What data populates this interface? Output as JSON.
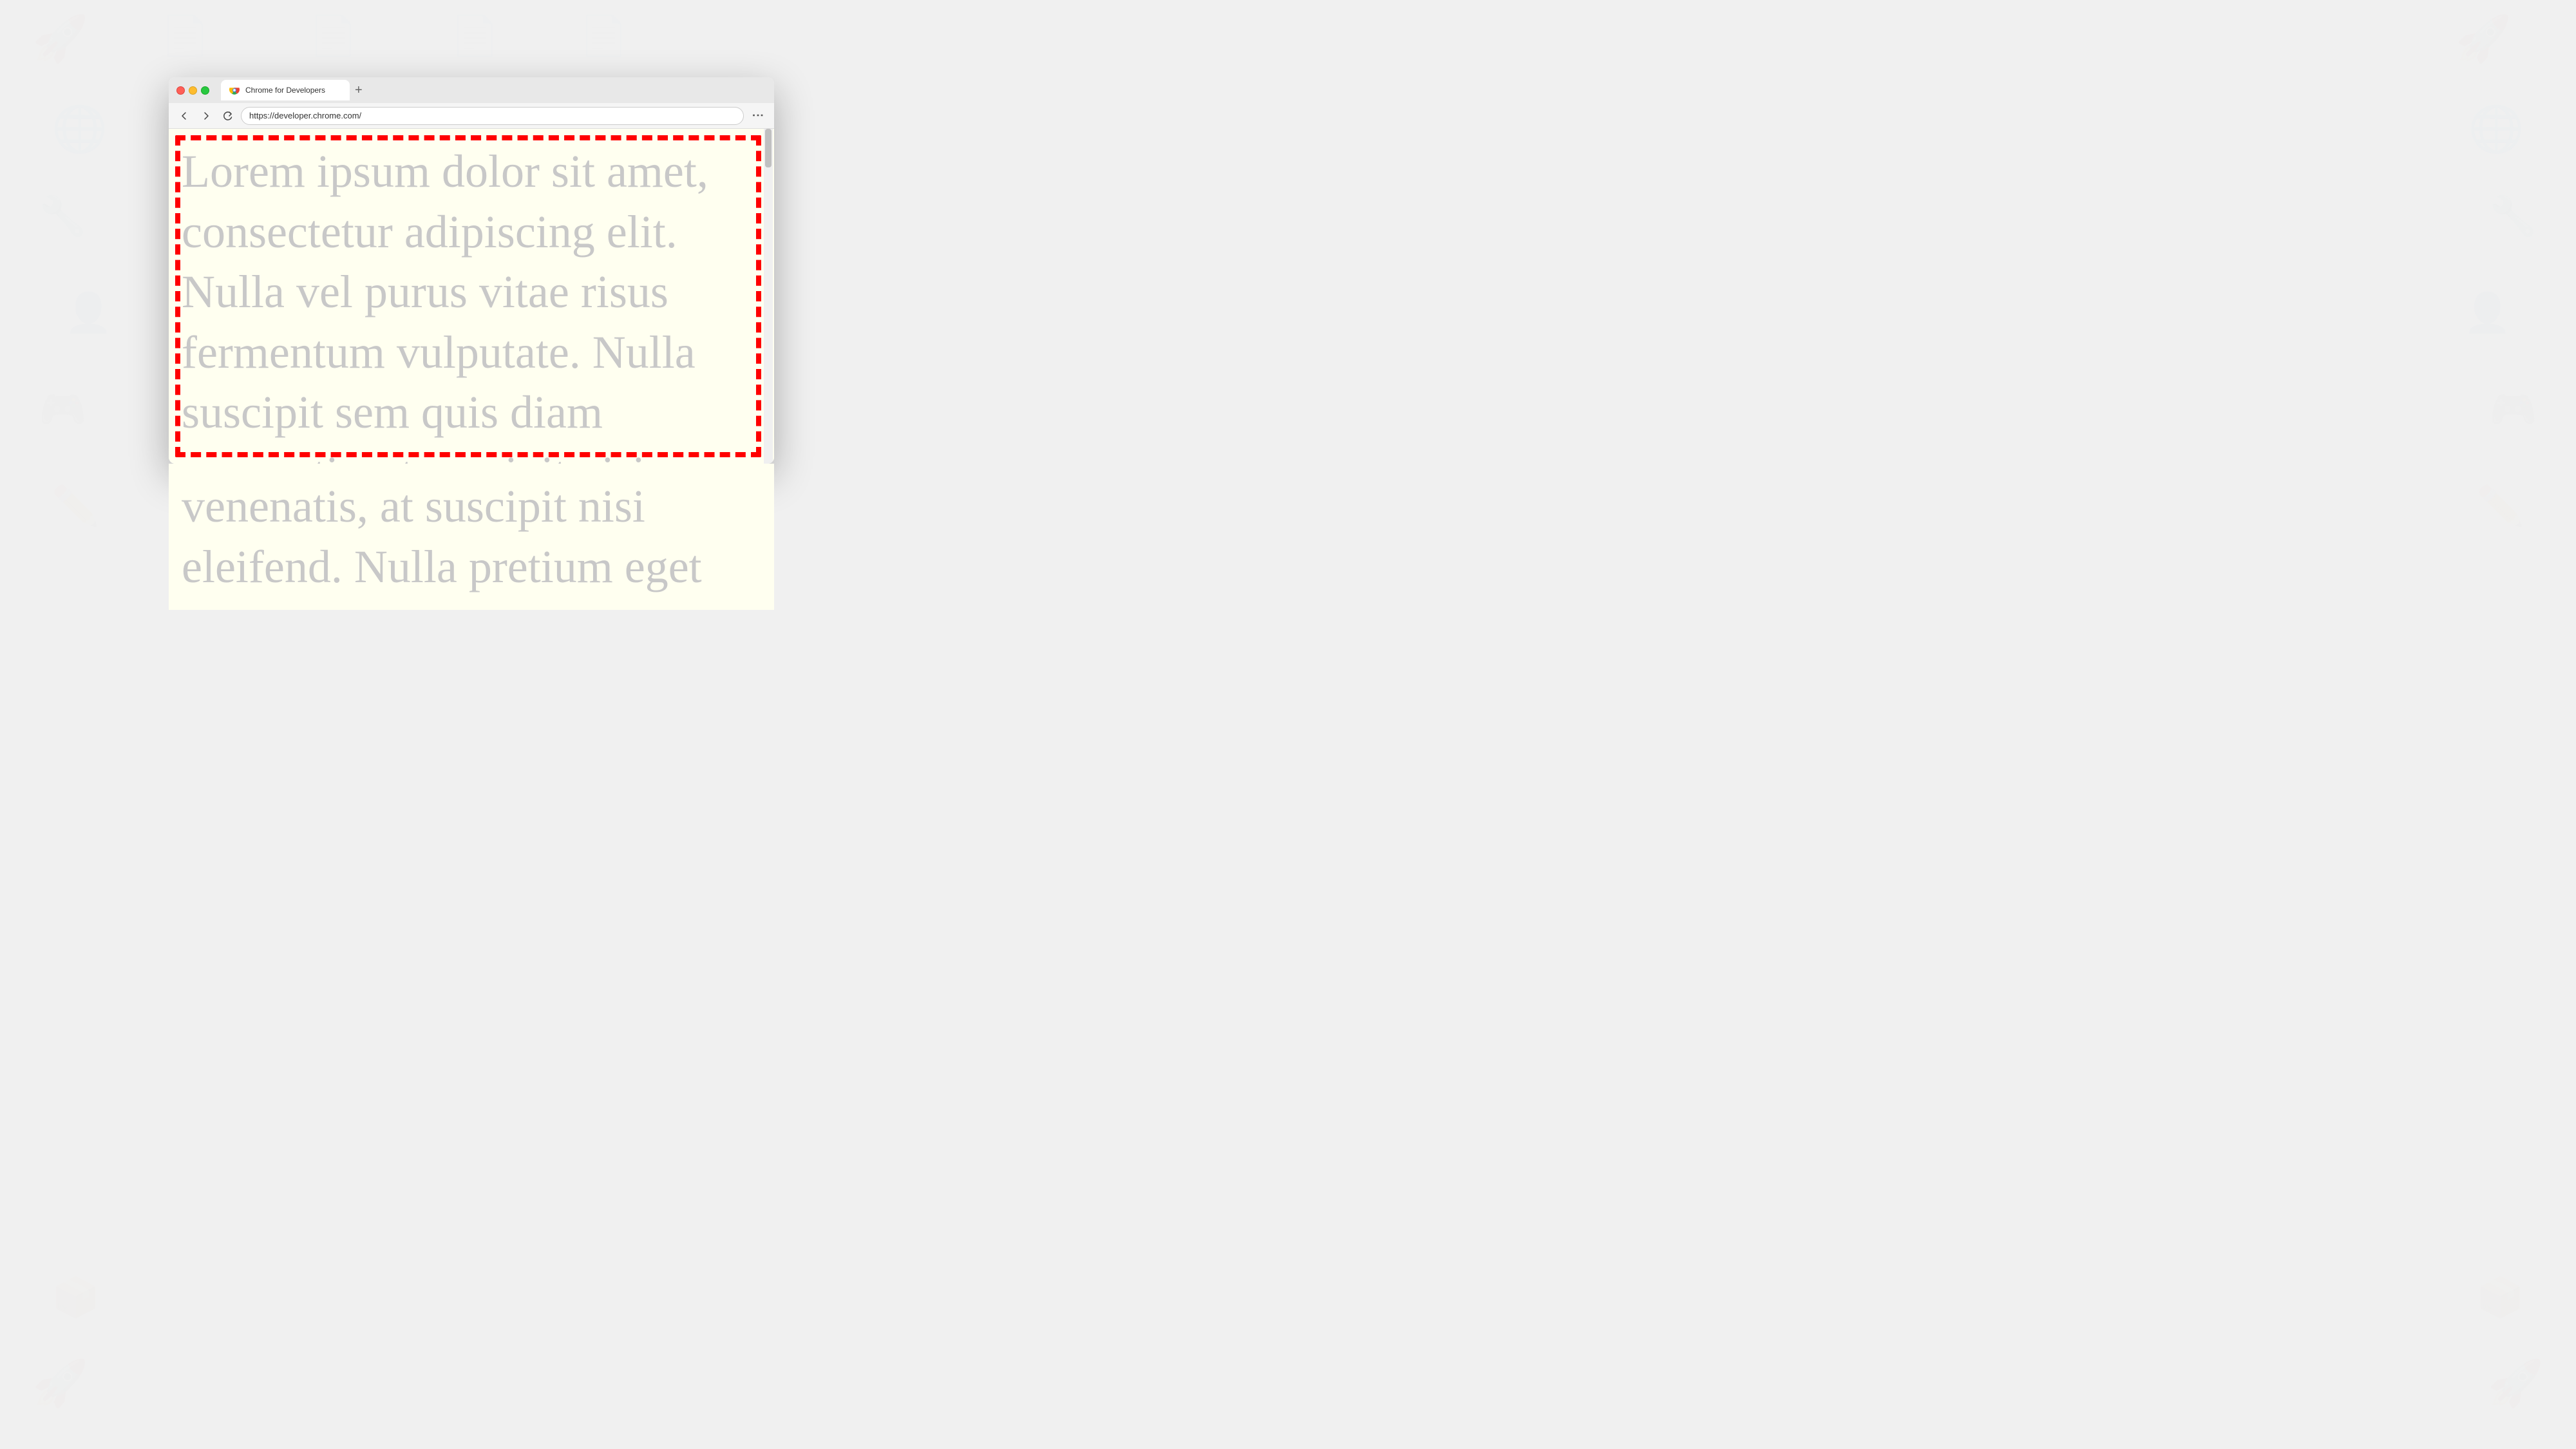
{
  "background": {
    "color": "#f0f0f0"
  },
  "browser": {
    "tab_title": "Chrome for Developers",
    "tab_url": "https://developer.chrome.com/",
    "new_tab_icon": "+",
    "back_btn": "←",
    "forward_btn": "→",
    "reload_btn": "↻",
    "more_btn": "⋮",
    "address_placeholder": "https://developer.chrome.com/"
  },
  "webpage": {
    "lorem_text": "Lorem ipsum dolor sit amet, consectetur adipiscing elit. Nulla vel purus vitae risus fermentum vulputate. Nulla suscipit sem quis diam venenatis, at suscipit nisi eleifend. Nulla pretium eget",
    "below_text": "venenatis, at suscipit nisi eleifend. Nulla pretium eget"
  },
  "traffic_lights": {
    "close_color": "#ff5f57",
    "minimize_color": "#febc2e",
    "maximize_color": "#28c840"
  }
}
